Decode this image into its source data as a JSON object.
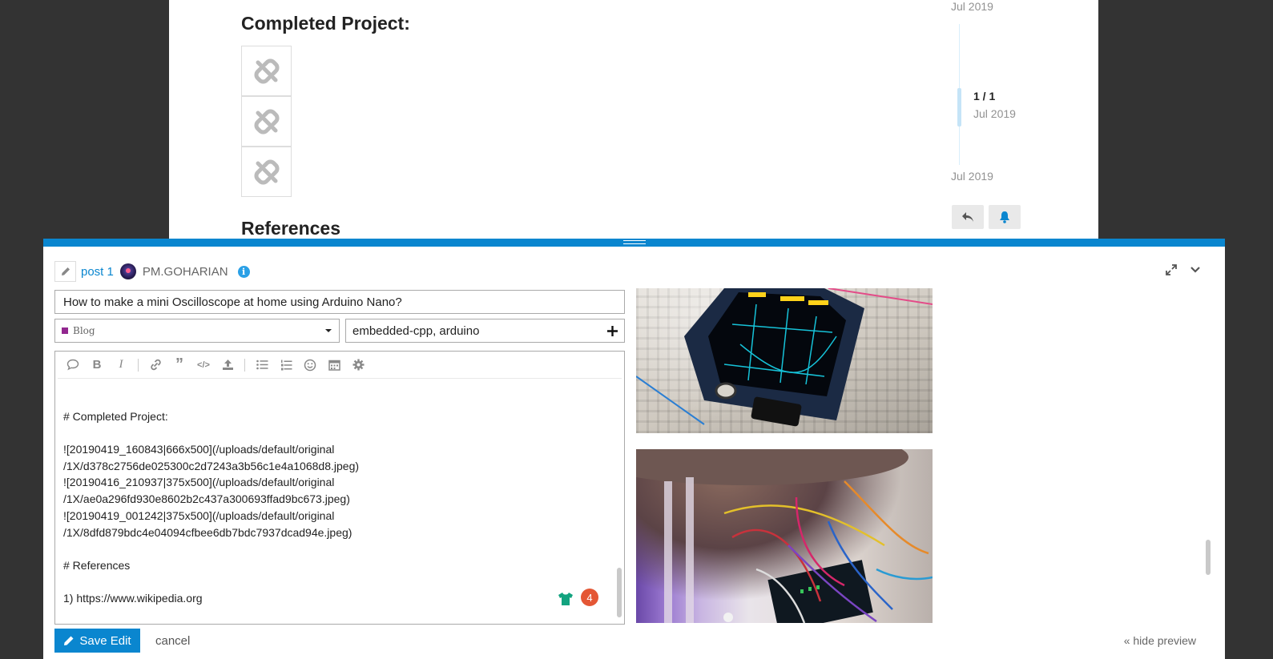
{
  "topic": {
    "heading_completed": "Completed Project:",
    "heading_references": "References",
    "timeline": {
      "top_date": "Jul 2019",
      "count": "1 / 1",
      "current_date": "Jul 2019",
      "bottom_date": "Jul 2019"
    }
  },
  "composer": {
    "post_link": "post 1",
    "username": "PM.GOHARIAN",
    "info_icon": "i",
    "title_value": "How to make a mini Oscilloscope at home using Arduino Nano?",
    "category": {
      "label": "Blog",
      "color": "#92278f"
    },
    "tags_value": "embedded-cpp, arduino",
    "editor_lines": [
      "",
      "# Completed Project:",
      "",
      "![20190419_160843|666x500](/uploads/default/original",
      "/1X/d378c2756de025300c2d7243a3b56c1e4a1068d8.jpeg)",
      "![20190416_210937|375x500](/uploads/default/original",
      "/1X/ae0a296fd930e8602b2c437a300693ffad9bc673.jpeg)",
      "![20190419_001242|375x500](/uploads/default/original",
      "/1X/8dfd879bdc4e04094cfbee6db7bdc7937dcad94e.jpeg)",
      "",
      "# References",
      "",
      "1) https://www.wikipedia.org"
    ],
    "badge_count": "4",
    "save_label": "Save Edit",
    "cancel_label": "cancel",
    "hide_preview_label": "« hide preview"
  },
  "colors": {
    "accent": "#0a86cf",
    "badge": "#e45735",
    "category": "#92278f"
  }
}
